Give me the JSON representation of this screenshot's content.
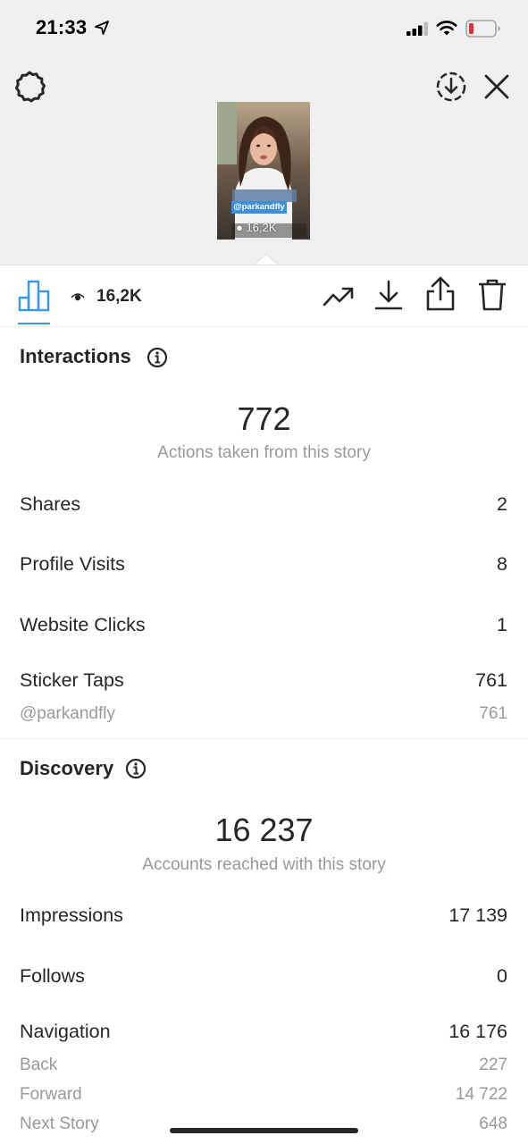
{
  "status_bar": {
    "time": "21:33"
  },
  "header": {
    "thumbnail": {
      "tag": "@parkandfly",
      "views": "16,2K"
    }
  },
  "toolbar": {
    "views": "16,2K"
  },
  "interactions": {
    "title": "Interactions",
    "total": "772",
    "caption": "Actions taken from this story",
    "rows": [
      {
        "label": "Shares",
        "value": "2"
      },
      {
        "label": "Profile Visits",
        "value": "8"
      },
      {
        "label": "Website Clicks",
        "value": "1"
      },
      {
        "label": "Sticker Taps",
        "value": "761"
      }
    ],
    "sticker_sub": {
      "label": "@parkandfly",
      "value": "761"
    }
  },
  "discovery": {
    "title": "Discovery",
    "total": "16 237",
    "caption": "Accounts reached with this story",
    "rows": [
      {
        "label": "Impressions",
        "value": "17 139"
      },
      {
        "label": "Follows",
        "value": "0"
      },
      {
        "label": "Navigation",
        "value": "16 176"
      }
    ],
    "navigation_sub": [
      {
        "label": "Back",
        "value": "227"
      },
      {
        "label": "Forward",
        "value": "14 722"
      },
      {
        "label": "Next Story",
        "value": "648"
      }
    ]
  },
  "colors": {
    "accent": "#3897f0",
    "text": "#262626",
    "muted": "#999999",
    "header_bg": "#efefef",
    "battery_low": "#e0332f"
  },
  "icons": [
    "location-arrow-icon",
    "signal-icon",
    "wifi-icon",
    "battery-icon",
    "settings-icon",
    "download-circle-icon",
    "close-icon",
    "bar-chart-icon",
    "eye-icon",
    "trend-icon",
    "download-icon",
    "share-icon",
    "trash-icon",
    "info-icon"
  ]
}
